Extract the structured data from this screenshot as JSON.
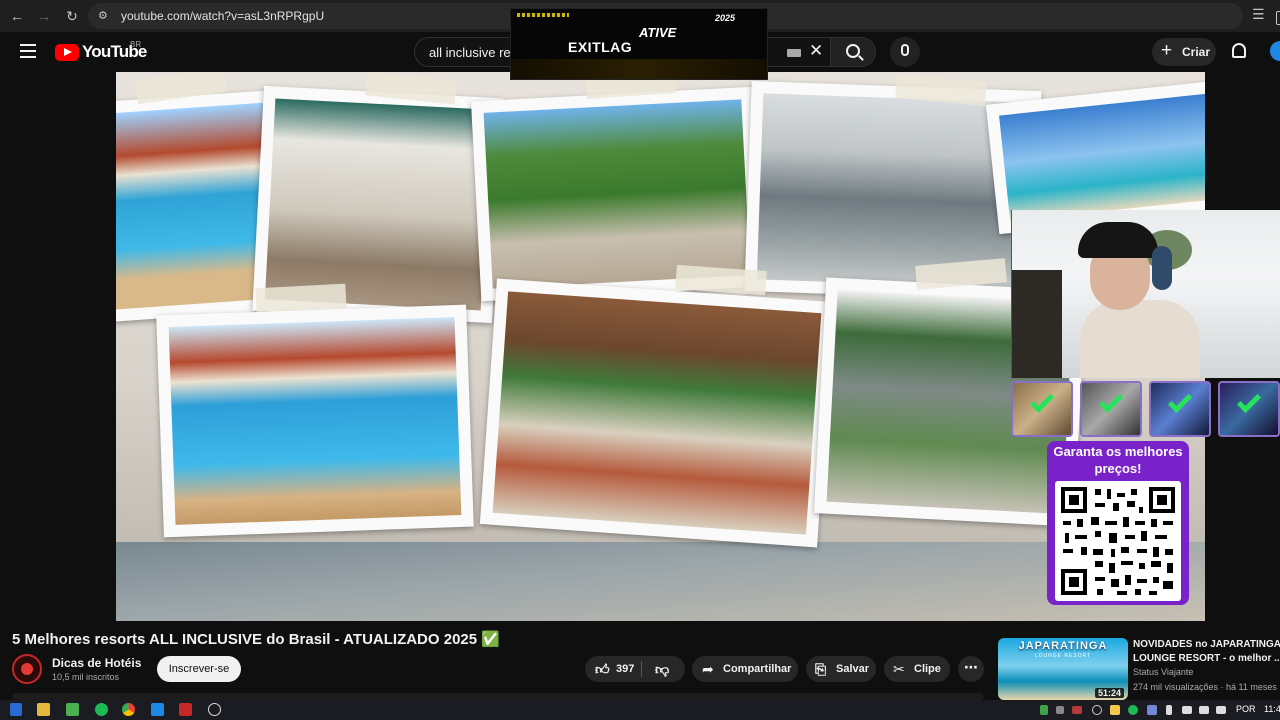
{
  "browser": {
    "url": "youtube.com/watch?v=asL3nRPRgpU"
  },
  "header": {
    "logo_text": "YouTube",
    "country_code": "BR",
    "search_value": "all inclusive  res",
    "create_label": "Criar"
  },
  "overlay": {
    "logo": "EXITLAG",
    "cta": "ATIVE",
    "year_badge": "2025"
  },
  "promo": {
    "title": "Garanta os melhores preços!"
  },
  "video": {
    "title": "5 Melhores resorts ALL INCLUSIVE do Brasil - ATUALIZADO 2025 ✅",
    "channel_name": "Dicas de Hotéis",
    "channel_subs": "10,5 mil inscritos",
    "subscribe_label": "Inscrever-se",
    "like_count": "397",
    "share_label": "Compartilhar",
    "save_label": "Salvar",
    "clip_label": "Clipe"
  },
  "recommended": {
    "thumb_title": "JAPARATINGA",
    "thumb_subtitle": "LOUNGE RESORT",
    "duration": "51:24",
    "title_line1": "NOVIDADES no JAPARATINGA",
    "title_line2": "LOUNGE RESORT - o melhor ...",
    "channel": "Status Viajante",
    "meta": "274 mil visualizações · há 11 meses"
  },
  "taskbar": {
    "language": "POR",
    "clock": "11:4"
  },
  "colors": {
    "yt_red": "#ff0000",
    "promo_purple": "#7a22c9",
    "check_green": "#27e35b"
  }
}
